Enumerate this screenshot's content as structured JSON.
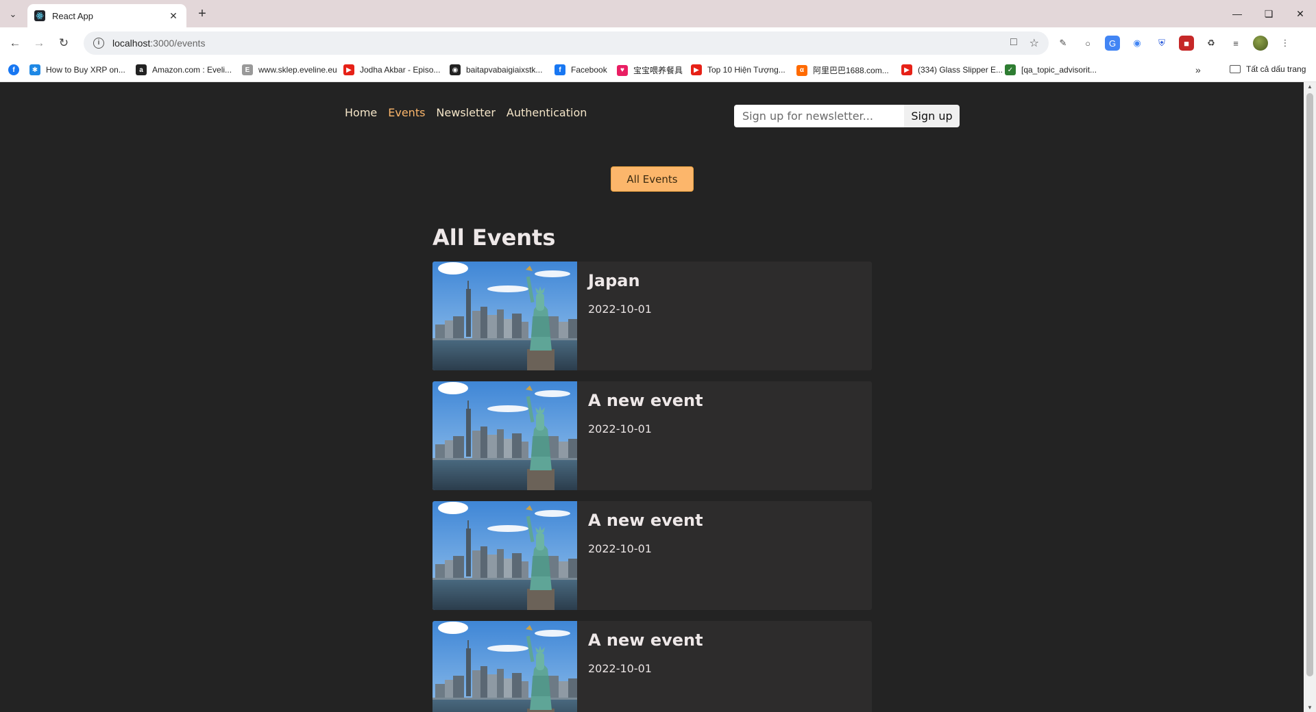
{
  "browser": {
    "tab_title": "React App",
    "url_host": "localhost",
    "url_path": ":3000/events",
    "bookmarks": [
      {
        "label": "How to Buy XRP on...",
        "icon": "ripple-icon",
        "color": "#1e88e5"
      },
      {
        "label": "Amazon.com : Eveli...",
        "icon": "amazon-icon",
        "color": "#222222"
      },
      {
        "label": "www.sklep.eveline.eu",
        "icon": "eveline-icon",
        "color": "#999999"
      },
      {
        "label": "Jodha Akbar - Episo...",
        "icon": "youtube-icon",
        "color": "#e62117"
      },
      {
        "label": "baitapvabaigiaixstk...",
        "icon": "globe-icon",
        "color": "#222222"
      },
      {
        "label": "Facebook",
        "icon": "facebook-icon",
        "color": "#1877f2"
      },
      {
        "label": "宝宝喂养餐具",
        "icon": "shop-icon",
        "color": "#e91e63"
      },
      {
        "label": "Top 10 Hiện Tượng...",
        "icon": "youtube-icon",
        "color": "#e62117"
      },
      {
        "label": "阿里巴巴1688.com...",
        "icon": "alibaba-icon",
        "color": "#ff6a00"
      },
      {
        "label": "(334) Glass Slipper E...",
        "icon": "youtube-icon",
        "color": "#e62117"
      },
      {
        "label": "[qa_topic_advisorit...",
        "icon": "qa-icon",
        "color": "#2e7d32"
      }
    ],
    "bookmarks_folder": "Tất cả dấu trang"
  },
  "nav": {
    "home": "Home",
    "events": "Events",
    "newsletter": "Newsletter",
    "authentication": "Authentication"
  },
  "newsletter_form": {
    "placeholder": "Sign up for newsletter...",
    "button": "Sign up"
  },
  "events_nav": {
    "all_events_button": "All Events"
  },
  "page_title": "All Events",
  "events": [
    {
      "title": "Japan",
      "date": "2022-10-01"
    },
    {
      "title": "A new event",
      "date": "2022-10-01"
    },
    {
      "title": "A new event",
      "date": "2022-10-01"
    },
    {
      "title": "A new event",
      "date": "2022-10-01"
    }
  ],
  "colors": {
    "accent": "#fcb66b",
    "background": "#232323",
    "card": "#2d2c2c"
  }
}
